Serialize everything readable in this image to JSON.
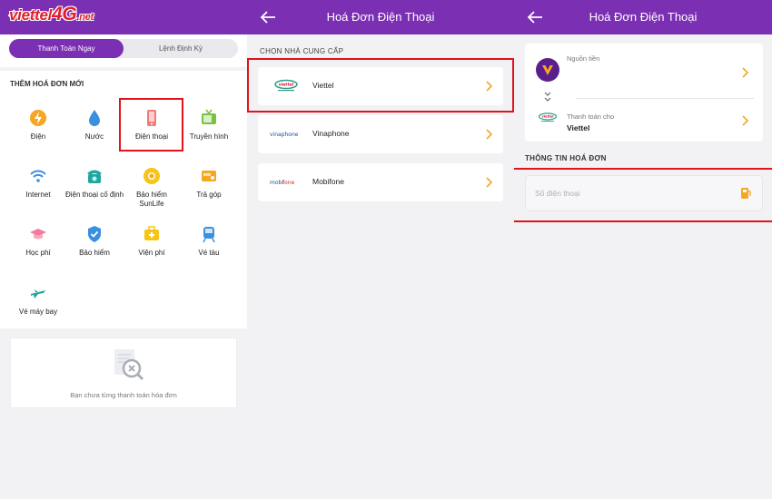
{
  "panel1": {
    "brand": {
      "text": "viettel",
      "highlight": "4G",
      "suffix": ".net"
    },
    "tabs": {
      "active": "Thanh Toán Ngay",
      "inactive": "Lệnh Định Kỳ"
    },
    "section_title": "THÊM HOÁ ĐƠN MỚI",
    "services": [
      {
        "label": "Điện",
        "icon": "lightning-icon"
      },
      {
        "label": "Nước",
        "icon": "water-drop-icon"
      },
      {
        "label": "Điện thoại",
        "icon": "phone-icon"
      },
      {
        "label": "Truyền hình",
        "icon": "tv-icon"
      },
      {
        "label": "Internet",
        "icon": "wifi-icon"
      },
      {
        "label": "Điện thoại cố định",
        "icon": "landline-icon"
      },
      {
        "label": "Bảo hiểm SunLife",
        "icon": "sunlife-icon"
      },
      {
        "label": "Trả góp",
        "icon": "installment-icon"
      },
      {
        "label": "Học phí",
        "icon": "graduation-cap-icon"
      },
      {
        "label": "Bảo hiểm",
        "icon": "shield-icon"
      },
      {
        "label": "Viện phí",
        "icon": "medical-kit-icon"
      },
      {
        "label": "Vé tàu",
        "icon": "train-icon"
      },
      {
        "label": "Vé máy bay",
        "icon": "airplane-icon"
      }
    ],
    "empty_text": "Bạn chưa từng thanh toán hóa đơn"
  },
  "panel2": {
    "title": "Hoá Đơn Điện Thoại",
    "section_label": "CHỌN NHÀ CUNG CẤP",
    "providers": [
      {
        "name": "Viettel",
        "logo": "viettel-logo"
      },
      {
        "name": "Vinaphone",
        "logo": "vinaphone-logo"
      },
      {
        "name": "Mobifone",
        "logo": "mobifone-logo"
      }
    ]
  },
  "panel3": {
    "title": "Hoá Đơn Điện Thoại",
    "source_label": "Nguồn tiền",
    "pay_for_label": "Thanh toán cho",
    "pay_for_value": "Viettel",
    "section_label": "THÔNG TIN HOÁ ĐƠN",
    "phone_placeholder": "Số điện thoại"
  },
  "colors": {
    "brand_purple": "#7b2fb3",
    "highlight_red": "#e3121b",
    "accent_orange": "#f5a623"
  }
}
